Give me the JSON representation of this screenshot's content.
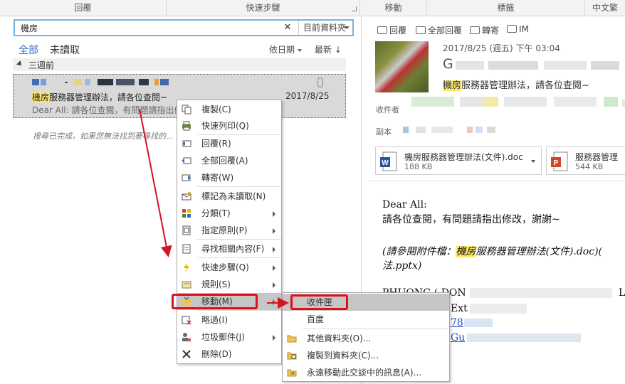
{
  "ribbon": {
    "groups": [
      "回覆",
      "快速步驟",
      "移動",
      "標籤",
      "中文繁"
    ]
  },
  "search": {
    "query": "機房",
    "clear": "✕",
    "scope": "目前資料夾"
  },
  "filters": {
    "all": "全部",
    "unread": "未讀取"
  },
  "sort": {
    "by_date": "依日期",
    "newest": "最新 ↓"
  },
  "group_header": "三週前",
  "message": {
    "subject_highlight": "機房",
    "subject_rest": "服務器管理辦法，請各位查閱~",
    "date": "2017/8/25",
    "preview": "Dear All:  請各位查閱，有問題請指出修"
  },
  "notice": "搜尋已完成，如果您無法找到要尋找的... 再試一次。",
  "reading": {
    "actions": [
      "回覆",
      "全部回覆",
      "轉寄",
      "IM"
    ],
    "date": "2017/8/25 (週五) 下午 03:04",
    "from_initial": "G",
    "subject_highlight": "機房",
    "subject_rest": "服務器管理辦法，請各位查閱~",
    "to_label": "收件者",
    "cc_label": "副本",
    "attachments": [
      {
        "name": "機房服務器管理辦法(文件).doc",
        "size": "188 KB"
      },
      {
        "name": "服務器管理",
        "size": "544 KB"
      }
    ],
    "body": {
      "greeting": "Dear All:",
      "line1": "請各位查閱，有問題請指出修改，謝謝~",
      "line2_pre": "(請參閱附件檔：",
      "line2_hl": "機房",
      "line2_post": "服務器管理辦法(文件).doc)(",
      "line3": "法.pptx)",
      "sig1": "PHUONG ( DON",
      "sig1_end": "L",
      "sig2": "Ext",
      "sig3": "78",
      "sig4": "Gu"
    }
  },
  "context_menu": {
    "items": [
      {
        "label": "複製(C)",
        "icon": "copy-icon"
      },
      {
        "label": "快速列印(Q)",
        "icon": "print-icon"
      },
      {
        "label": "回覆(R)",
        "icon": "reply-icon"
      },
      {
        "label": "全部回覆(A)",
        "icon": "reply-all-icon"
      },
      {
        "label": "轉寄(W)",
        "icon": "forward-icon"
      },
      {
        "label": "標記為未讀取(N)",
        "icon": "mark-unread-icon"
      },
      {
        "label": "分類(T)",
        "icon": "categorize-icon"
      },
      {
        "label": "指定原則(P)",
        "icon": "policy-icon"
      },
      {
        "label": "尋找相關內容(F)",
        "icon": "find-related-icon"
      },
      {
        "label": "快速步驟(Q)",
        "icon": "quick-steps-icon"
      },
      {
        "label": "規則(S)",
        "icon": "rules-icon"
      },
      {
        "label": "移動(M)",
        "icon": "move-icon"
      },
      {
        "label": "略過(I)",
        "icon": "ignore-icon"
      },
      {
        "label": "垃圾郵件(J)",
        "icon": "junk-icon"
      },
      {
        "label": "刪除(D)",
        "icon": "delete-icon"
      }
    ]
  },
  "move_submenu": {
    "items": [
      {
        "label": "收件匣",
        "icon": ""
      },
      {
        "label": "百度",
        "icon": ""
      },
      {
        "label": "其他資料夾(O)...",
        "icon": "folder-icon"
      },
      {
        "label": "複製到資料夾(C)...",
        "icon": "copy-to-folder-icon"
      },
      {
        "label": "永遠移動此交談中的訊息(A)...",
        "icon": "always-move-icon"
      }
    ]
  },
  "colors": {
    "accent": "#2c72c7",
    "highlight": "#fde86b",
    "annotation_red": "#e0101b"
  }
}
